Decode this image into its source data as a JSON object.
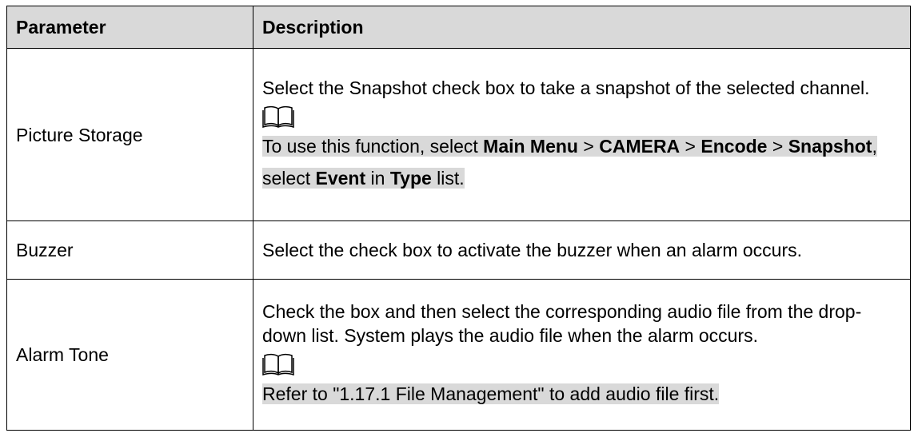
{
  "header": {
    "parameter": "Parameter",
    "description": "Description"
  },
  "rows": [
    {
      "parameter": "Picture Storage",
      "description": "Select the Snapshot check box to take a snapshot of the selected channel.",
      "note": {
        "t1": "To use this function, select ",
        "b1": "Main Menu",
        "t2": " > ",
        "b2": "CAMERA",
        "t3": " > ",
        "b3": "Encode",
        "t4": " > ",
        "b4": "Snapshot",
        "t5": ", select ",
        "b5": "Event",
        "t6": " in ",
        "b6": "Type",
        "t7": " list."
      }
    },
    {
      "parameter": "Buzzer",
      "description": "Select the check box to activate the buzzer when an alarm occurs."
    },
    {
      "parameter": "Alarm Tone",
      "description": "Check the box and then select the corresponding audio file from the drop-down list. System plays the audio file when the alarm occurs.",
      "note": {
        "text": "Refer to \"1.17.1 File Management\" to add audio file first."
      }
    }
  ],
  "colors": {
    "header_bg": "#d9d9d9",
    "note_highlight": "#d9d9d9",
    "border": "#000000"
  },
  "icons": {
    "note": "open-book-icon"
  }
}
